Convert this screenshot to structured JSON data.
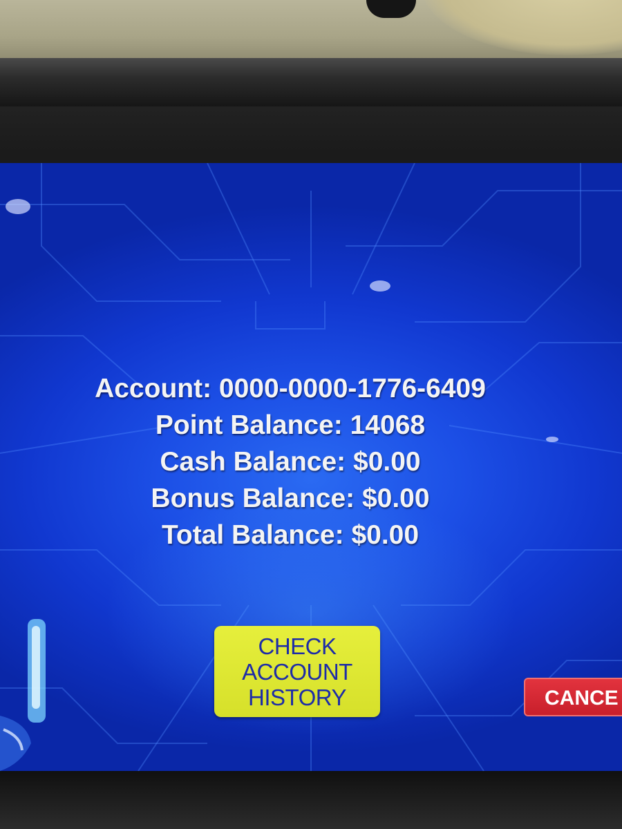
{
  "account": {
    "account_line": "Account: 0000-0000-1776-6409",
    "point_balance_line": "Point Balance: 14068",
    "cash_balance_line": "Cash Balance: $0.00",
    "bonus_balance_line": "Bonus Balance: $0.00",
    "total_balance_line": "Total Balance: $0.00"
  },
  "buttons": {
    "check_history": [
      "CHECK",
      "ACCOUNT",
      "HISTORY"
    ],
    "cancel_label": "CANCE"
  },
  "colors": {
    "screen_blue": "#1c4fe6",
    "check_button_yellow": "#dde633",
    "check_button_text": "#1d2ca8",
    "cancel_button_red": "#d62833"
  }
}
